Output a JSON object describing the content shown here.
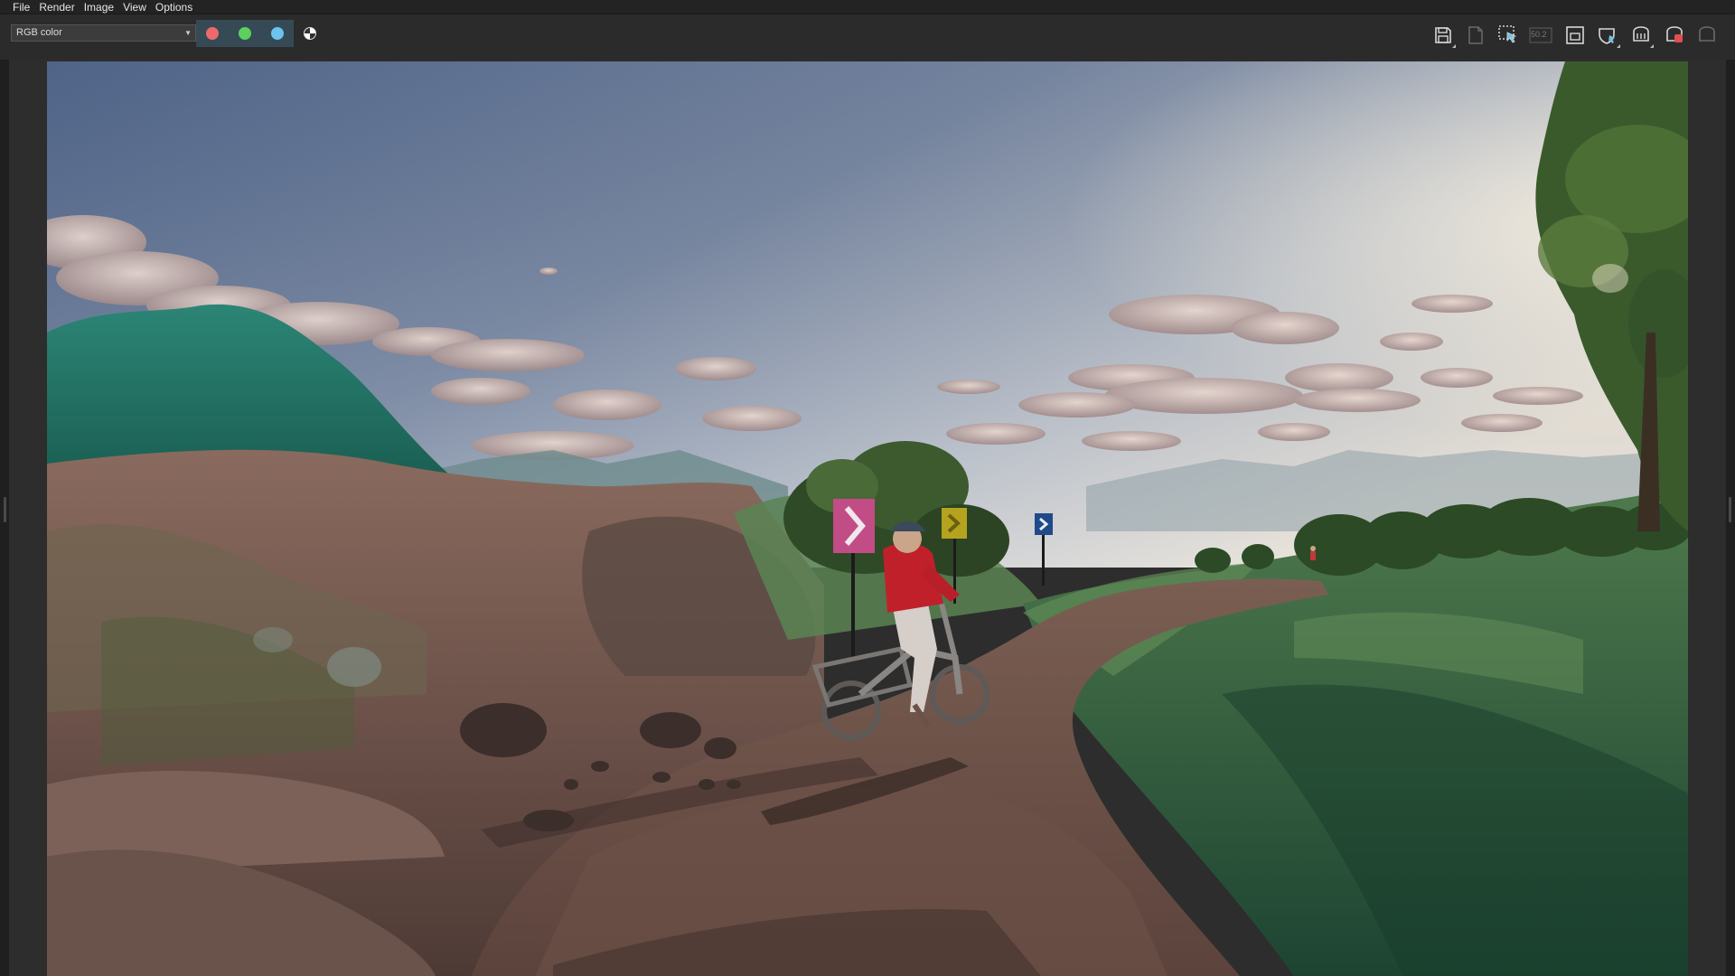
{
  "menu": [
    "File",
    "Render",
    "Image",
    "View",
    "Options"
  ],
  "toolbar": {
    "channel_select": "RGB color",
    "channels": [
      {
        "name": "red",
        "color": "#ee6a6a",
        "active": false
      },
      {
        "name": "green",
        "color": "#5ccf5c",
        "active": false
      },
      {
        "name": "blue",
        "color": "#6cc3ee",
        "active": true
      },
      {
        "name": "alpha",
        "color": "#ffffff",
        "active": false
      }
    ],
    "zoom_label": "50.2"
  },
  "icons": [
    "save-icon",
    "save-multilayer-icon",
    "region-select-icon",
    "zoom-readout-icon",
    "fit-frame-icon",
    "shield-icon",
    "cpu-render-icon",
    "stop-render-icon",
    "clear-render-icon"
  ],
  "colors": {
    "accent": "#364a55",
    "background": "#2b2b2b"
  }
}
